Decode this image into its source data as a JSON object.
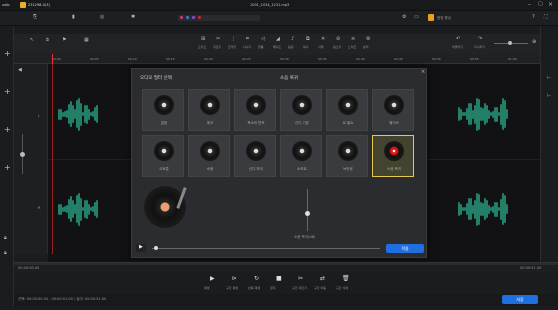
{
  "titlebar": {
    "app_name": "udio",
    "project": "231298-0(3)",
    "file": "1001_1034_1231.mp3",
    "menu_hint": "음정 향상"
  },
  "toolbar": {
    "labels": [
      "오디오",
      "자르기",
      "쪼개기",
      "나누기",
      "볼륨",
      "페이드",
      "음성",
      "복사",
      "삭제",
      "음소거",
      "노이즈",
      "분리"
    ],
    "right_labels": [
      "되돌리기",
      "다시하기"
    ]
  },
  "ruler": {
    "ticks": [
      "00:00",
      "00:05",
      "00:10",
      "00:15",
      "00:20",
      "00:25",
      "00:30",
      "00:35",
      "00:40",
      "00:45",
      "00:50",
      "00:55",
      "01:00"
    ]
  },
  "tracks": {
    "left_label": "L",
    "right_label": "R"
  },
  "dialog": {
    "title_left": "오디오 필터 선택",
    "title_center": "소음 복귀",
    "tiles": [
      "없음",
      "에코",
      "목소리 변조",
      "신디 기본",
      "로 블쇼",
      "웨이브",
      "오토튠",
      "소음",
      "신디 하이",
      "소프트",
      "브라운",
      "소음 복귀"
    ],
    "slider_label": "소음 복귀(dB)",
    "apply_button": "적용"
  },
  "bottombar": {
    "left_time": "00:00:00.00",
    "right_time": "00:00:51.00"
  },
  "transport": {
    "labels": [
      "재생",
      "구간 재생",
      "반복 재생",
      "정지",
      "구간 자르기",
      "구간 이동",
      "구간 삭제"
    ]
  },
  "status": {
    "info": "선택: 00:00:00.00 - 00:00:51.00 / 길이: 00:00:51.00"
  },
  "save_button": "저장"
}
